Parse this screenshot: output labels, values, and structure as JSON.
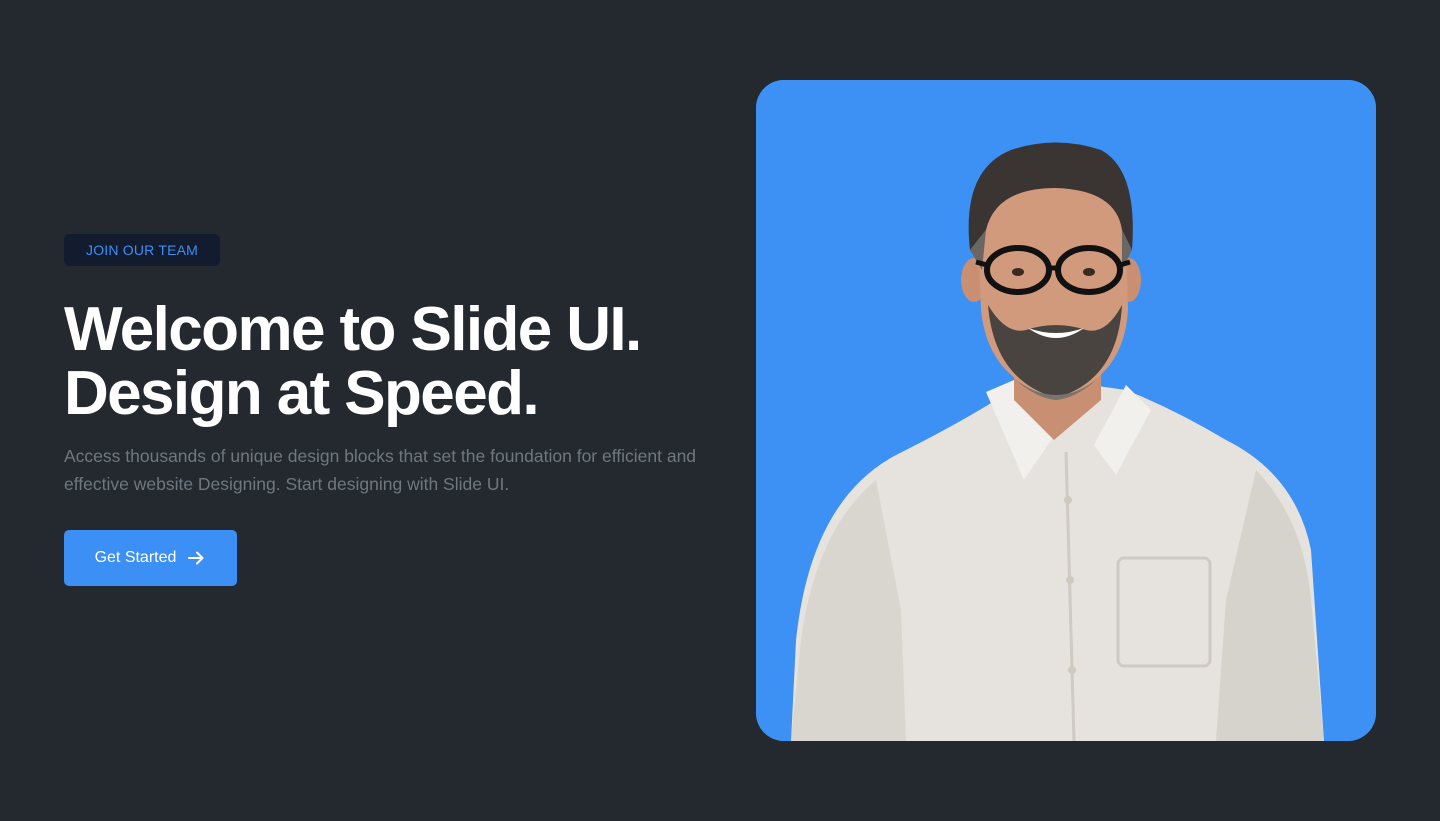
{
  "hero": {
    "badge": "JOIN OUR TEAM",
    "headline_line1": "Welcome to Slide UI.",
    "headline_line2": "Design at Speed.",
    "description": "Access thousands of unique design blocks that set the foundation for efficient and effective website Designing. Start designing with Slide UI.",
    "cta_label": "Get Started",
    "cta_icon": "arrow-right-icon"
  },
  "image": {
    "subject": "smiling man with glasses and beard in white shirt"
  },
  "colors": {
    "background": "#23292f",
    "accent": "#3b8ff5",
    "badge_bg": "#121c2e",
    "photo_bg": "#3d90f4",
    "heading": "#ffffff",
    "body_text": "#6f7780"
  }
}
